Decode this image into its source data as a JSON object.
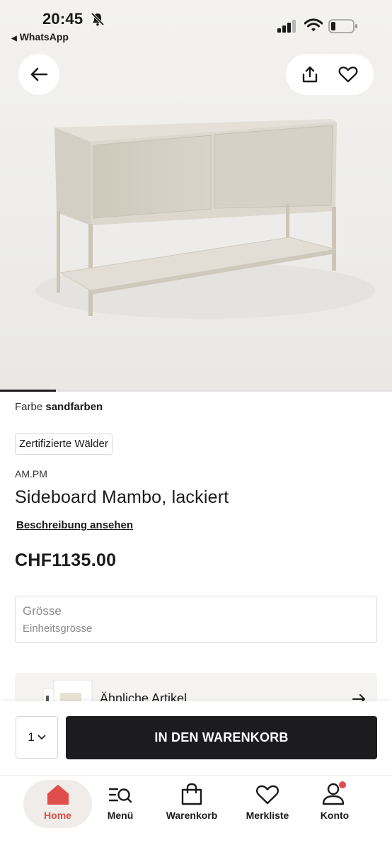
{
  "status_bar": {
    "time": "20:45",
    "back_app": "WhatsApp",
    "icons": [
      "bell-off-icon",
      "cellular-signal-icon",
      "wifi-icon",
      "battery-icon"
    ]
  },
  "hero": {
    "image": "sideboard-photo",
    "icons": [
      "arrow-left-icon",
      "share-icon",
      "heart-icon"
    ]
  },
  "product": {
    "color_label": "Farbe",
    "color_value": "sandfarben",
    "badge": "Zertifizierte Wälder",
    "brand": "AM.PM",
    "title": "Sideboard Mambo, lackiert",
    "description_link": "Beschreibung ansehen",
    "price": "CHF1135.00"
  },
  "size_selector": {
    "label": "Grösse",
    "value": "Einheitsgrösse"
  },
  "similar": {
    "label": "Ähnliche Artikel"
  },
  "cart_bar": {
    "quantity": "1",
    "add_to_cart_label": "IN DEN WARENKORB"
  },
  "tab_bar": {
    "items": [
      {
        "label": "Home",
        "icon": "home-icon",
        "active": true
      },
      {
        "label": "Menü",
        "icon": "menu-search-icon"
      },
      {
        "label": "Warenkorb",
        "icon": "shopping-bag-icon"
      },
      {
        "label": "Merkliste",
        "icon": "heart-icon"
      },
      {
        "label": "Konto",
        "icon": "account-icon"
      }
    ]
  },
  "colors": {
    "accent": "#e04d4d",
    "button_dark": "#1c1c1f",
    "hero_bg": "#efeeec",
    "furniture": "#d8d3c8"
  }
}
